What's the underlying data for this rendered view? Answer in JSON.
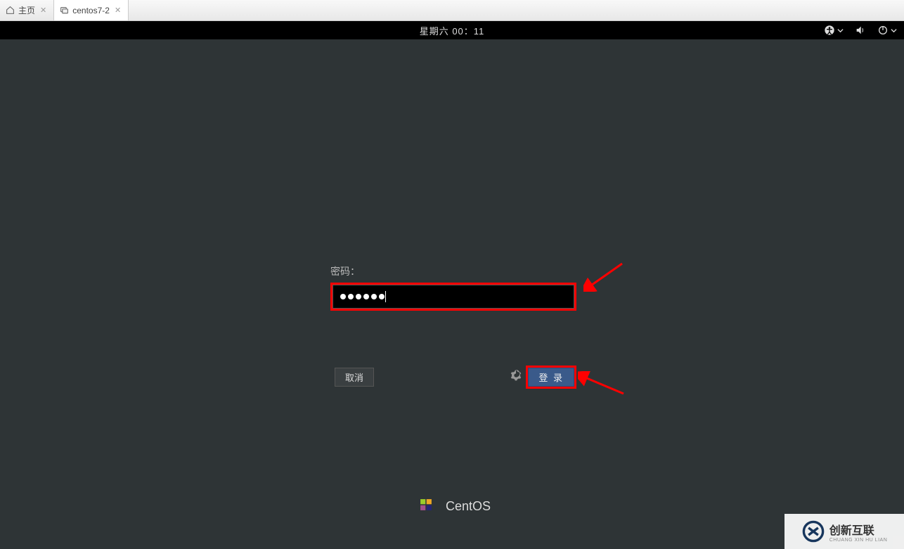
{
  "tabs": {
    "home": "主页",
    "vm": "centos7-2"
  },
  "topbar": {
    "datetime": "星期六 00：11"
  },
  "login": {
    "password_label": "密码：",
    "password_value_dots": 6,
    "cancel_label": "取消",
    "login_label": "登 录"
  },
  "footer": {
    "distro": "CentOS"
  },
  "watermark": {
    "brand": "创新互联",
    "sub": "CHUANG XIN HU LIAN"
  }
}
